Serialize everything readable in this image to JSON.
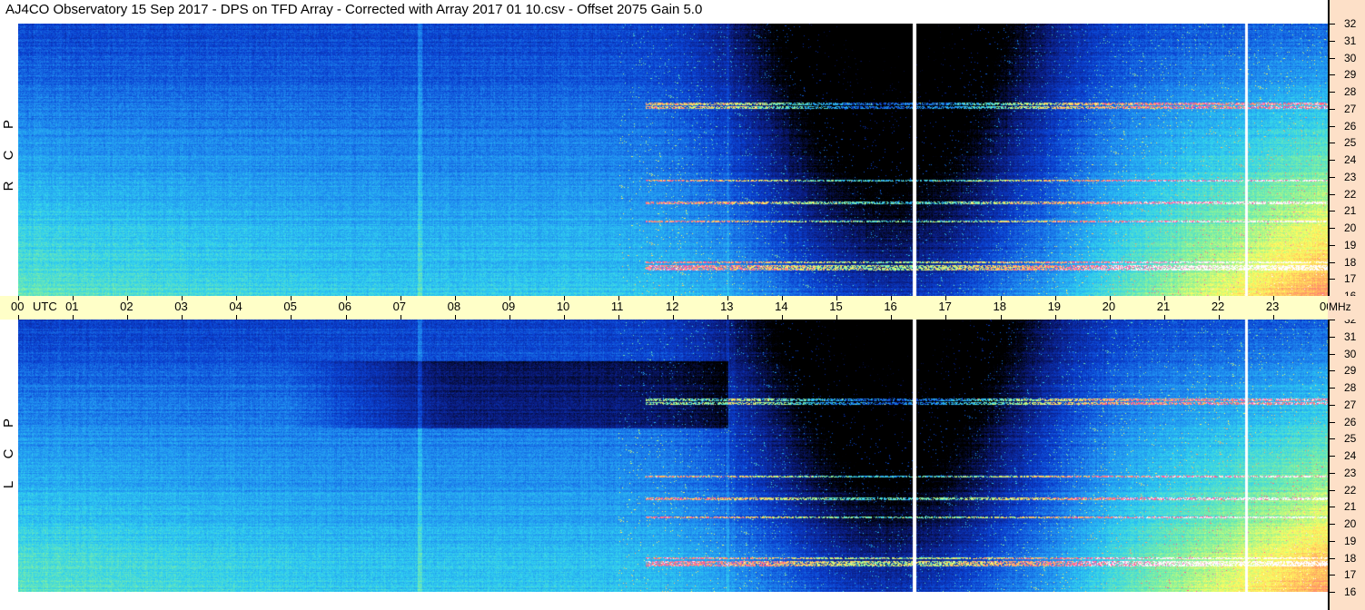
{
  "title": "AJ4CO Observatory  15 Sep 2017  -  DPS on TFD Array  -  Corrected with Array 2017 01 10.csv  -  Offset 2075  Gain 5.0",
  "chart_data": {
    "type": "heatmap",
    "title": "AJ4CO Observatory  15 Sep 2017  -  DPS on TFD Array  -  Corrected with Array 2017 01 10.csv  -  Offset 2075  Gain 5.0",
    "x_unit": "UTC",
    "y_unit": "MHz",
    "x_ticks": [
      "00",
      "01",
      "02",
      "03",
      "04",
      "05",
      "06",
      "07",
      "08",
      "09",
      "10",
      "11",
      "12",
      "13",
      "14",
      "15",
      "16",
      "17",
      "18",
      "19",
      "20",
      "21",
      "22",
      "23",
      "00"
    ],
    "y_ticks": [
      "16",
      "17",
      "18",
      "19",
      "20",
      "21",
      "22",
      "23",
      "24",
      "25",
      "26",
      "27",
      "28",
      "29",
      "30",
      "31",
      "32"
    ],
    "xlim": [
      0,
      24
    ],
    "ylim": [
      16,
      32
    ],
    "panels": [
      {
        "name": "RCP",
        "label": [
          "R",
          "C",
          "P"
        ]
      },
      {
        "name": "LCP",
        "label": [
          "L",
          "C",
          "P"
        ]
      }
    ],
    "colormap": [
      "#000000",
      "#0a1a7a",
      "#0a3fd0",
      "#1f8cf0",
      "#30d0f0",
      "#80f0a0",
      "#ffff60",
      "#ffa060",
      "#ff40a0",
      "#ffffff"
    ],
    "data_gaps_utc": [
      16.42,
      22.5
    ],
    "rfi_bands_mhz": [
      17.6,
      17.75,
      18.0,
      20.4,
      21.5,
      22.8,
      27.1,
      27.3
    ],
    "grid": false
  }
}
